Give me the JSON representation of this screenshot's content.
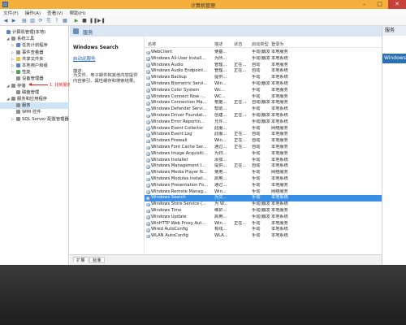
{
  "window": {
    "title": "计算机管理"
  },
  "menu": [
    "文件(F)",
    "操作(A)",
    "查看(V)",
    "帮助(H)"
  ],
  "tree": [
    {
      "label": "计算机管理(本地)",
      "indent": 0,
      "icon": "computer-icon",
      "tone": "blue",
      "expander": ""
    },
    {
      "label": "系统工具",
      "indent": 1,
      "icon": "tools-icon",
      "tone": "gray",
      "expander": "◢"
    },
    {
      "label": "任务计划程序",
      "indent": 2,
      "icon": "clock-icon",
      "tone": "blue",
      "expander": "▷"
    },
    {
      "label": "事件查看器",
      "indent": 2,
      "icon": "event-viewer-icon",
      "tone": "gray",
      "expander": "▷"
    },
    {
      "label": "共享文件夹",
      "indent": 2,
      "icon": "folder-icon",
      "tone": "yellow",
      "expander": "▷"
    },
    {
      "label": "本地用户和组",
      "indent": 2,
      "icon": "users-icon",
      "tone": "blue",
      "expander": "▷"
    },
    {
      "label": "性能",
      "indent": 2,
      "icon": "performance-icon",
      "tone": "green",
      "expander": "▷"
    },
    {
      "label": "设备管理器",
      "indent": 2,
      "icon": "device-manager-icon",
      "tone": "gray",
      "expander": ""
    },
    {
      "label": "存储",
      "indent": 1,
      "icon": "storage-icon",
      "tone": "gray",
      "expander": "◢"
    },
    {
      "label": "磁盘管理",
      "indent": 2,
      "icon": "disk-icon",
      "tone": "gray",
      "expander": ""
    },
    {
      "label": "服务和应用程序",
      "indent": 1,
      "icon": "services-apps-icon",
      "tone": "gray",
      "expander": "◢"
    },
    {
      "label": "服务",
      "indent": 2,
      "icon": "gear-icon",
      "tone": "gray",
      "expander": "",
      "selected": true
    },
    {
      "label": "WMI 控件",
      "indent": 2,
      "icon": "wmi-icon",
      "tone": "gray",
      "expander": ""
    },
    {
      "label": "SQL Server 配置管理器",
      "indent": 2,
      "icon": "sql-icon",
      "tone": "gray",
      "expander": "▷"
    }
  ],
  "annotation": "1. 找到服务",
  "panel": {
    "title": "服务"
  },
  "desc": {
    "name": "Windows Search",
    "link": "启动此服务",
    "label": "描述:",
    "text": "为文件、电子邮件和其他内容提供内容索引、属性缓存和搜索结果。"
  },
  "columns": {
    "name": "名称",
    "desc": "描述",
    "status": "状态",
    "startup": "启动类型",
    "logon": "登录为"
  },
  "services": [
    {
      "name": "WebClient",
      "desc": "使基...",
      "status": "",
      "startup": "手动(触发...",
      "logon": "本地服务"
    },
    {
      "name": "Windows All-User Install...",
      "desc": "为所...",
      "status": "",
      "startup": "手动(触发...",
      "logon": "本地系统"
    },
    {
      "name": "Windows Audio",
      "desc": "管理...",
      "status": "正在...",
      "startup": "自动",
      "logon": "本地服务"
    },
    {
      "name": "Windows Audio Endpoint...",
      "desc": "管理...",
      "status": "正在...",
      "startup": "自动",
      "logon": "本地系统"
    },
    {
      "name": "Windows Backup",
      "desc": "提供...",
      "status": "",
      "startup": "手动",
      "logon": "本地系统"
    },
    {
      "name": "Windows Biometric Servi...",
      "desc": "Win...",
      "status": "",
      "startup": "手动(触发...",
      "logon": "本地系统"
    },
    {
      "name": "Windows Color System",
      "desc": "Wc...",
      "status": "",
      "startup": "手动",
      "logon": "本地服务"
    },
    {
      "name": "Windows Connect Now -...",
      "desc": "WC...",
      "status": "",
      "startup": "手动",
      "logon": "本地服务"
    },
    {
      "name": "Windows Connection Ma...",
      "desc": "根据...",
      "status": "正在...",
      "startup": "自动(触发...",
      "logon": "本地服务"
    },
    {
      "name": "Windows Defender Servi...",
      "desc": "帮助...",
      "status": "",
      "startup": "手动",
      "logon": "本地系统"
    },
    {
      "name": "Windows Driver Foundat...",
      "desc": "创建...",
      "status": "正在...",
      "startup": "手动(触发...",
      "logon": "本地系统"
    },
    {
      "name": "Windows Error Reportin...",
      "desc": "允许...",
      "status": "",
      "startup": "手动(触发...",
      "logon": "本地系统"
    },
    {
      "name": "Windows Event Collector",
      "desc": "此服...",
      "status": "",
      "startup": "手动",
      "logon": "网络服务"
    },
    {
      "name": "Windows Event Log",
      "desc": "此服...",
      "status": "正在...",
      "startup": "自动",
      "logon": "本地服务"
    },
    {
      "name": "Windows Firewall",
      "desc": "Win...",
      "status": "正在...",
      "startup": "自动",
      "logon": "本地服务"
    },
    {
      "name": "Windows Font Cache Ser...",
      "desc": "通过...",
      "status": "正在...",
      "startup": "自动",
      "logon": "本地服务"
    },
    {
      "name": "Windows Image Acquisiti...",
      "desc": "为扫...",
      "status": "",
      "startup": "手动",
      "logon": "本地服务"
    },
    {
      "name": "Windows Installer",
      "desc": "添加...",
      "status": "",
      "startup": "手动",
      "logon": "本地系统"
    },
    {
      "name": "Windows Management I...",
      "desc": "提供...",
      "status": "正在...",
      "startup": "自动",
      "logon": "本地系统"
    },
    {
      "name": "Windows Media Player N...",
      "desc": "使用...",
      "status": "",
      "startup": "手动",
      "logon": "网络服务"
    },
    {
      "name": "Windows Modules Install...",
      "desc": "启用...",
      "status": "",
      "startup": "手动",
      "logon": "本地系统"
    },
    {
      "name": "Windows Presentation Fo...",
      "desc": "通过...",
      "status": "",
      "startup": "手动",
      "logon": "本地服务"
    },
    {
      "name": "Windows Remote Manag...",
      "desc": "Win...",
      "status": "",
      "startup": "手动",
      "logon": "网络服务"
    },
    {
      "name": "Windows Search",
      "desc": "为文...",
      "status": "",
      "startup": "手动",
      "logon": "本地系统",
      "selected": true
    },
    {
      "name": "Windows Store Service (...",
      "desc": "为 W...",
      "status": "",
      "startup": "手动(触发...",
      "logon": "本地系统"
    },
    {
      "name": "Windows Time",
      "desc": "维护...",
      "status": "",
      "startup": "手动(触发...",
      "logon": "本地服务"
    },
    {
      "name": "Windows Update",
      "desc": "启用...",
      "status": "",
      "startup": "手动(触发...",
      "logon": "本地系统"
    },
    {
      "name": "WinHTTP Web Proxy Aut...",
      "desc": "Win...",
      "status": "正在...",
      "startup": "手动",
      "logon": "本地服务"
    },
    {
      "name": "Wired AutoConfig",
      "desc": "有线...",
      "status": "",
      "startup": "手动",
      "logon": "本地系统"
    },
    {
      "name": "WLAN AutoConfig",
      "desc": "WLA...",
      "status": "",
      "startup": "手动",
      "logon": "本地系统"
    }
  ],
  "tabs": [
    "扩展",
    "标准"
  ],
  "actions": {
    "title": "服务",
    "item": "Windows Search"
  }
}
